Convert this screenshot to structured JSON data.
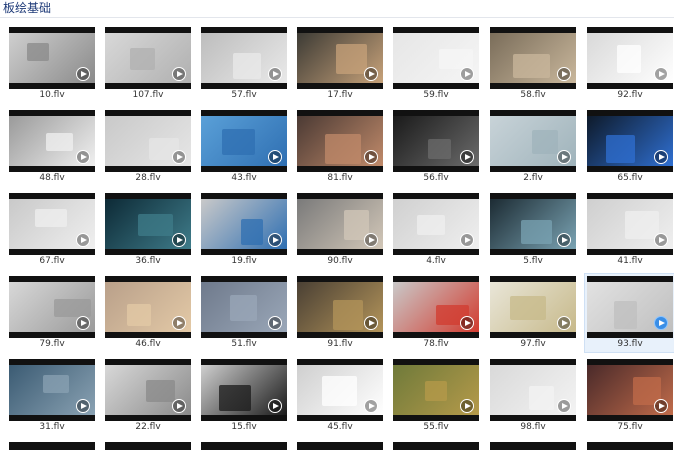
{
  "header": {
    "title": "板绘基础"
  },
  "files": [
    "10.flv",
    "107.flv",
    "57.flv",
    "17.flv",
    "59.flv",
    "58.flv",
    "92.flv",
    "48.flv",
    "28.flv",
    "43.flv",
    "81.flv",
    "56.flv",
    "2.flv",
    "65.flv",
    "67.flv",
    "36.flv",
    "19.flv",
    "90.flv",
    "4.flv",
    "5.flv",
    "41.flv",
    "79.flv",
    "46.flv",
    "51.flv",
    "91.flv",
    "78.flv",
    "97.flv",
    "93.flv",
    "31.flv",
    "22.flv",
    "15.flv",
    "45.flv",
    "55.flv",
    "98.flv",
    "75.flv"
  ],
  "selected_file": "93.flv",
  "colors": {
    "title": "#1e3a78",
    "selection": "#e8f1fb",
    "play_active": "#3a8ee6"
  }
}
